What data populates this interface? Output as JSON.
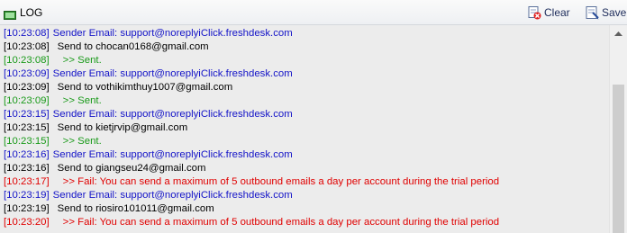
{
  "toolbar": {
    "title": "LOG",
    "clear_label": "Clear",
    "save_label": "Save"
  },
  "log": [
    {
      "ts": "[10:23:08]",
      "msg": "Sender Email: support@noreplyiClick.freshdesk.com",
      "kind": "sender"
    },
    {
      "ts": "[10:23:08]",
      "msg": "Send to chocan0168@gmail.com",
      "kind": "send"
    },
    {
      "ts": "[10:23:08]",
      "msg": ">> Sent.",
      "kind": "sent"
    },
    {
      "ts": "[10:23:09]",
      "msg": "Sender Email: support@noreplyiClick.freshdesk.com",
      "kind": "sender"
    },
    {
      "ts": "[10:23:09]",
      "msg": "Send to vothikimthuy1007@gmail.com",
      "kind": "send"
    },
    {
      "ts": "[10:23:09]",
      "msg": ">> Sent.",
      "kind": "sent"
    },
    {
      "ts": "[10:23:15]",
      "msg": "Sender Email: support@noreplyiClick.freshdesk.com",
      "kind": "sender"
    },
    {
      "ts": "[10:23:15]",
      "msg": "Send to kietjrvip@gmail.com",
      "kind": "send"
    },
    {
      "ts": "[10:23:15]",
      "msg": ">> Sent.",
      "kind": "sent"
    },
    {
      "ts": "[10:23:16]",
      "msg": "Sender Email: support@noreplyiClick.freshdesk.com",
      "kind": "sender"
    },
    {
      "ts": "[10:23:16]",
      "msg": "Send to giangseu24@gmail.com",
      "kind": "send"
    },
    {
      "ts": "[10:23:17]",
      "msg": ">> Fail: You can send a maximum of 5 outbound emails a day per account during the trial period",
      "kind": "fail"
    },
    {
      "ts": "[10:23:19]",
      "msg": "Sender Email: support@noreplyiClick.freshdesk.com",
      "kind": "sender"
    },
    {
      "ts": "[10:23:19]",
      "msg": "Send to riosiro101011@gmail.com",
      "kind": "send"
    },
    {
      "ts": "[10:23:20]",
      "msg": ">> Fail: You can send a maximum of 5 outbound emails a day per account during the trial period",
      "kind": "fail"
    }
  ],
  "colors": {
    "sender": "#1414c8",
    "send": "#000000",
    "sent": "#1a9a1a",
    "fail": "#e00000"
  },
  "icons": {
    "title": "log-icon",
    "clear": "clear-icon",
    "save": "save-icon",
    "scroll_up": "scroll-up-arrow-icon"
  }
}
